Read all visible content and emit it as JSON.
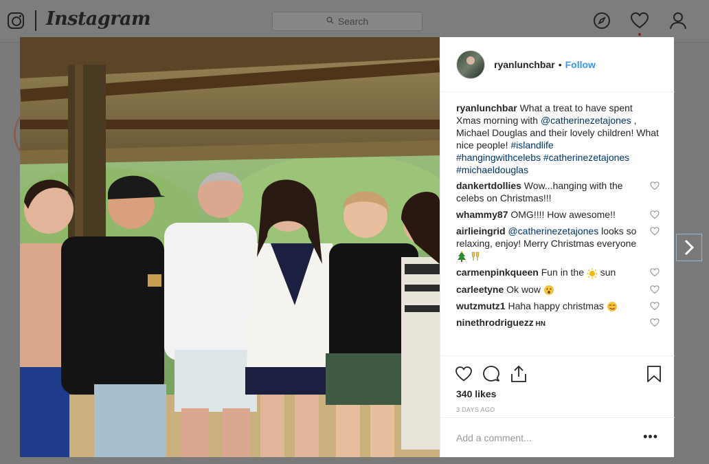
{
  "app": {
    "wordmark": "Instagram"
  },
  "search": {
    "placeholder": "Search"
  },
  "nav": {
    "icons": [
      "explore-compass-icon",
      "activity-heart-icon",
      "profile-person-icon"
    ]
  },
  "post": {
    "username": "ryanlunchbar",
    "separator": "•",
    "follow_label": "Follow",
    "caption": {
      "username": "ryanlunchbar",
      "text_1": " What a treat to have spent Xmas morning with ",
      "mention_1": "@catherinezetajones",
      "text_2": " , Michael Douglas and their lovely children! What nice people! ",
      "tag_1": "#islandlife",
      "tag_2": "#hangingwithcelebs",
      "tag_3": "#catherinezetajones",
      "tag_4": "#michaeldouglas"
    },
    "comments": [
      {
        "user": "dankertdollies",
        "text": " Wow...hanging with the celebs on Christmas!!!"
      },
      {
        "user": "whammy87",
        "text": " OMG!!!! How awesome!!"
      },
      {
        "user": "airlieingrid",
        "mention": "@catherinezetajones",
        "text": " looks so relaxing, enjoy! Merry Christmas everyone "
      },
      {
        "user": "carmenpinkqueen",
        "text": " Fun in the ",
        "text_2": " sun"
      },
      {
        "user": "carleetyne",
        "text": " Ok wow "
      },
      {
        "user": "wutzmutz1",
        "text": " Haha happy christmas "
      },
      {
        "user": "ninethrodriguezz",
        "text": " HN"
      }
    ],
    "likes": "340 likes",
    "date": "3 DAYS AGO",
    "add_comment_placeholder": "Add a comment...",
    "more_label": "•••"
  },
  "colors": {
    "link": "#3897f0",
    "tag": "#003569",
    "muted": "#999999",
    "overlay": "#7a7a7a"
  }
}
